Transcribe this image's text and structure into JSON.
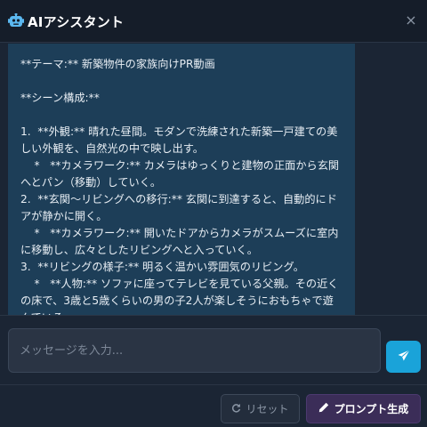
{
  "header": {
    "title": "AIアシスタント",
    "close_glyph": "×",
    "icon": "robot-icon"
  },
  "chat": {
    "message_lines": [
      "**テーマ:** 新築物件の家族向けPR動画",
      "",
      "**シーン構成:**",
      "",
      "1.  **外観:** 晴れた昼間。モダンで洗練された新築一戸建ての美しい外観を、自然光の中で映し出す。",
      "    *   **カメラワーク:** カメラはゆっくりと建物の正面から玄関へとパン（移動）していく。",
      "2.  **玄関〜リビングへの移行:** 玄関に到達すると、自動的にドアが静かに開く。",
      "    *   **カメラワーク:** 開いたドアからカメラがスムーズに室内に移動し、広々としたリビングへと入っていく。",
      "3.  **リビングの様子:** 明るく温かい雰囲気のリビング。",
      "    *   **人物:** ソファに座ってテレビを見ている父親。その近くの床で、3歳と5歳くらいの男の子2人が楽しそうにおもちゃで遊んでいる。"
    ]
  },
  "input": {
    "placeholder": "メッセージを入力...",
    "value": ""
  },
  "footer": {
    "reset_label": "リセット",
    "generate_label": "プロンプト生成"
  },
  "colors": {
    "header_bg": "#151d29",
    "panel_bg": "#1b2534",
    "bubble_bg": "#1d3e58",
    "send_button": "#1aa3d9",
    "generate_button": "#3b2d58"
  }
}
